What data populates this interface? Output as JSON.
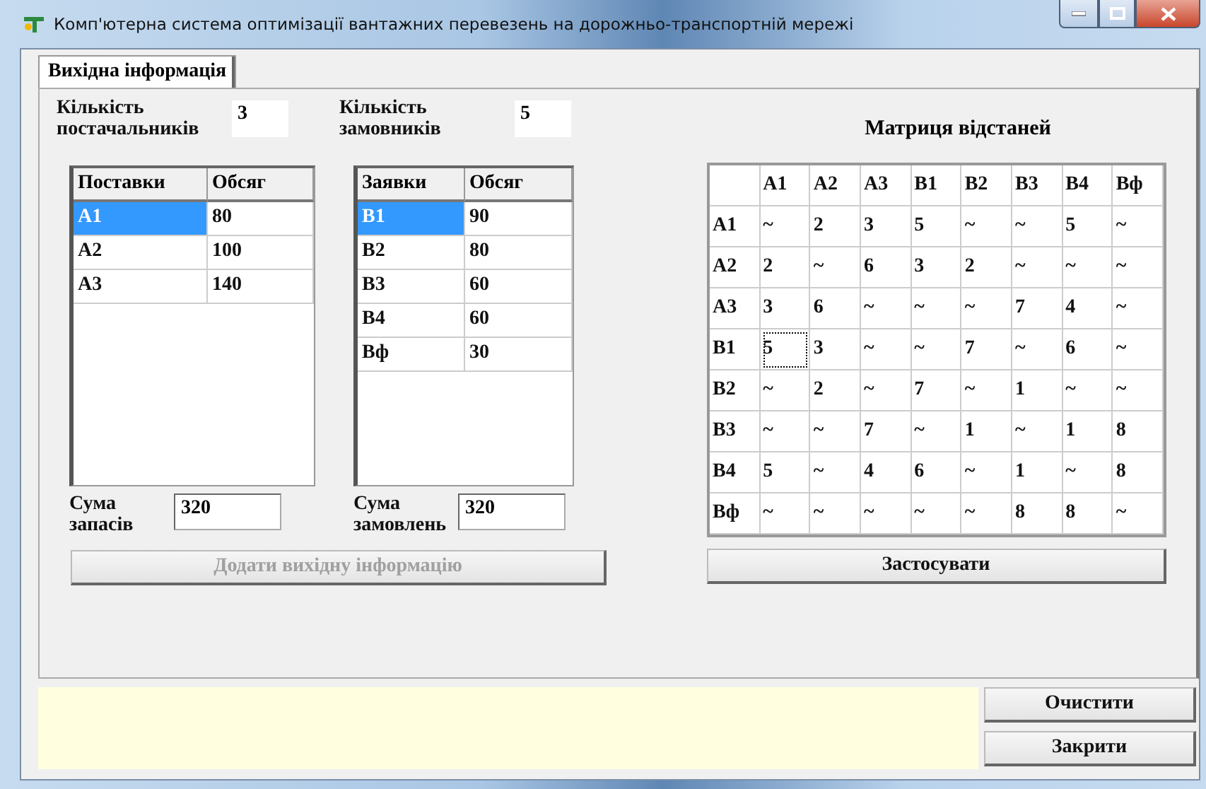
{
  "window": {
    "title": "Комп'ютерна система оптимізації вантажних перевезень на дорожньо-транспортній мережі"
  },
  "tabs": [
    {
      "label": "Вихідна інформація",
      "selected": true
    }
  ],
  "suppliers": {
    "count_label": "Кількість постачальників",
    "count": "3",
    "columns": [
      "Поставки",
      "Обсяг"
    ],
    "rows": [
      {
        "cells": [
          "A1",
          "80"
        ],
        "selected": true
      },
      {
        "cells": [
          "A2",
          "100"
        ],
        "selected": false
      },
      {
        "cells": [
          "A3",
          "140"
        ],
        "selected": false
      }
    ],
    "sum_label": "Сума запасів",
    "sum": "320"
  },
  "customers": {
    "count_label": "Кількість замовників",
    "count": "5",
    "columns": [
      "Заявки",
      "Обсяг"
    ],
    "rows": [
      {
        "cells": [
          "B1",
          "90"
        ],
        "selected": true
      },
      {
        "cells": [
          "B2",
          "80"
        ],
        "selected": false
      },
      {
        "cells": [
          "B3",
          "60"
        ],
        "selected": false
      },
      {
        "cells": [
          "B4",
          "60"
        ],
        "selected": false
      },
      {
        "cells": [
          "Вф",
          "30"
        ],
        "selected": false
      }
    ],
    "sum_label": "Сума замовлень",
    "sum": "320"
  },
  "add_button": {
    "label": "Додати вихідну інформацію",
    "disabled": true
  },
  "matrix": {
    "title": "Матриця відстаней",
    "columns": [
      "A1",
      "A2",
      "A3",
      "B1",
      "B2",
      "B3",
      "B4",
      "Вф"
    ],
    "rows": [
      {
        "label": "A1",
        "cells": [
          {
            "v": "~",
            "focused": false
          },
          {
            "v": "2",
            "focused": false
          },
          {
            "v": "3",
            "focused": false
          },
          {
            "v": "5",
            "focused": false
          },
          {
            "v": "~",
            "focused": false
          },
          {
            "v": "~",
            "focused": false
          },
          {
            "v": "5",
            "focused": false
          },
          {
            "v": "~",
            "focused": false
          }
        ]
      },
      {
        "label": "A2",
        "cells": [
          {
            "v": "2",
            "focused": false
          },
          {
            "v": "~",
            "focused": false
          },
          {
            "v": "6",
            "focused": false
          },
          {
            "v": "3",
            "focused": false
          },
          {
            "v": "2",
            "focused": false
          },
          {
            "v": "~",
            "focused": false
          },
          {
            "v": "~",
            "focused": false
          },
          {
            "v": "~",
            "focused": false
          }
        ]
      },
      {
        "label": "A3",
        "cells": [
          {
            "v": "3",
            "focused": false
          },
          {
            "v": "6",
            "focused": false
          },
          {
            "v": "~",
            "focused": false
          },
          {
            "v": "~",
            "focused": false
          },
          {
            "v": "~",
            "focused": false
          },
          {
            "v": "7",
            "focused": false
          },
          {
            "v": "4",
            "focused": false
          },
          {
            "v": "~",
            "focused": false
          }
        ]
      },
      {
        "label": "B1",
        "cells": [
          {
            "v": "5",
            "focused": true
          },
          {
            "v": "3",
            "focused": false
          },
          {
            "v": "~",
            "focused": false
          },
          {
            "v": "~",
            "focused": false
          },
          {
            "v": "7",
            "focused": false
          },
          {
            "v": "~",
            "focused": false
          },
          {
            "v": "6",
            "focused": false
          },
          {
            "v": "~",
            "focused": false
          }
        ]
      },
      {
        "label": "B2",
        "cells": [
          {
            "v": "~",
            "focused": false
          },
          {
            "v": "2",
            "focused": false
          },
          {
            "v": "~",
            "focused": false
          },
          {
            "v": "7",
            "focused": false
          },
          {
            "v": "~",
            "focused": false
          },
          {
            "v": "1",
            "focused": false
          },
          {
            "v": "~",
            "focused": false
          },
          {
            "v": "~",
            "focused": false
          }
        ]
      },
      {
        "label": "B3",
        "cells": [
          {
            "v": "~",
            "focused": false
          },
          {
            "v": "~",
            "focused": false
          },
          {
            "v": "7",
            "focused": false
          },
          {
            "v": "~",
            "focused": false
          },
          {
            "v": "1",
            "focused": false
          },
          {
            "v": "~",
            "focused": false
          },
          {
            "v": "1",
            "focused": false
          },
          {
            "v": "8",
            "focused": false
          }
        ]
      },
      {
        "label": "B4",
        "cells": [
          {
            "v": "5",
            "focused": false
          },
          {
            "v": "~",
            "focused": false
          },
          {
            "v": "4",
            "focused": false
          },
          {
            "v": "6",
            "focused": false
          },
          {
            "v": "~",
            "focused": false
          },
          {
            "v": "1",
            "focused": false
          },
          {
            "v": "~",
            "focused": false
          },
          {
            "v": "8",
            "focused": false
          }
        ]
      },
      {
        "label": "Вф",
        "cells": [
          {
            "v": "~",
            "focused": false
          },
          {
            "v": "~",
            "focused": false
          },
          {
            "v": "~",
            "focused": false
          },
          {
            "v": "~",
            "focused": false
          },
          {
            "v": "~",
            "focused": false
          },
          {
            "v": "8",
            "focused": false
          },
          {
            "v": "8",
            "focused": false
          },
          {
            "v": "~",
            "focused": false
          }
        ]
      }
    ]
  },
  "apply_button": {
    "label": "Застосувати",
    "disabled": false
  },
  "buttons": [
    {
      "label": "Очистити"
    },
    {
      "label": "Закрити"
    }
  ]
}
